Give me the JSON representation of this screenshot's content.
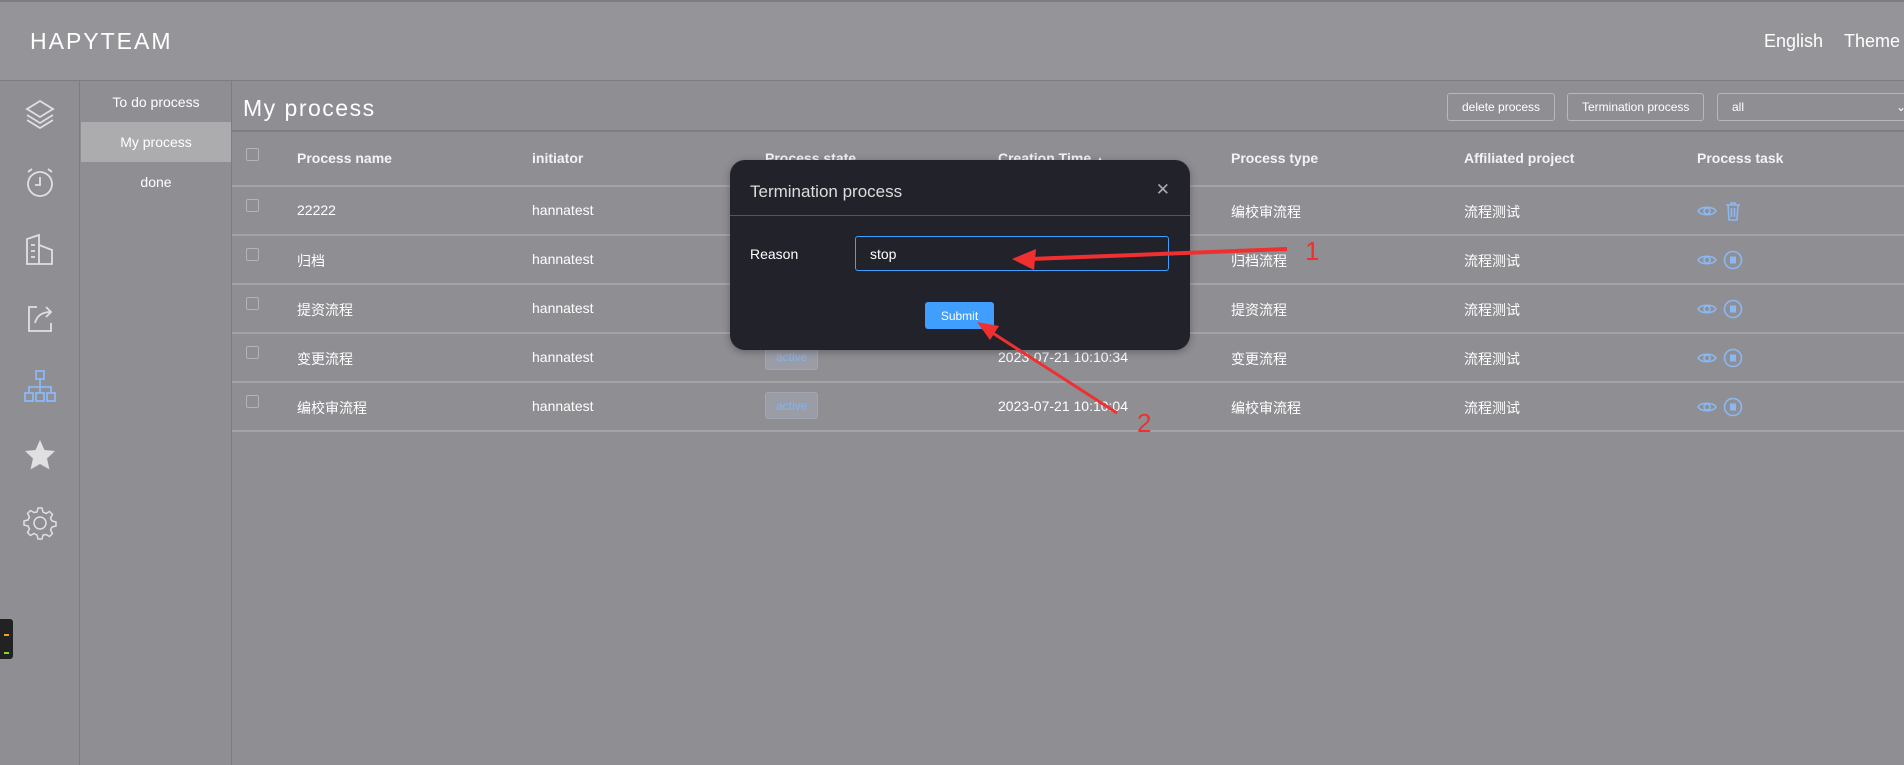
{
  "header": {
    "logo": "HAPYTEAM",
    "language": "English",
    "theme": "Theme"
  },
  "iconbar": [
    {
      "icon": "layers-icon"
    },
    {
      "icon": "alarm-clock-icon"
    },
    {
      "icon": "building-icon"
    },
    {
      "icon": "share-icon"
    },
    {
      "icon": "org-chart-icon",
      "active": true
    },
    {
      "icon": "star-icon"
    },
    {
      "icon": "gear-icon"
    }
  ],
  "submenu": {
    "items": [
      {
        "label": "To do process"
      },
      {
        "label": "My process",
        "active": true
      },
      {
        "label": "done"
      }
    ]
  },
  "main": {
    "title": "My process",
    "delete_label": "delete process",
    "termination_label": "Termination process",
    "filter_value": "all"
  },
  "table": {
    "headers": [
      "Process name",
      "initiator",
      "Process state",
      "Creation Time",
      "Process type",
      "Affiliated project",
      "Process task"
    ],
    "rows": [
      {
        "name": "22222",
        "initiator": "hannatest",
        "state": "",
        "time": "",
        "type": "编校审流程",
        "project": "流程测试",
        "task_icons": [
          "eye-icon",
          "trash-icon"
        ]
      },
      {
        "name": "归档",
        "initiator": "hannatest",
        "state": "",
        "time": "",
        "type": "归档流程",
        "project": "流程测试",
        "task_icons": [
          "eye-icon",
          "stop-icon"
        ]
      },
      {
        "name": "提资流程",
        "initiator": "hannatest",
        "state": "",
        "time": "",
        "type": "提资流程",
        "project": "流程测试",
        "task_icons": [
          "eye-icon",
          "stop-icon"
        ]
      },
      {
        "name": "变更流程",
        "initiator": "hannatest",
        "state": "active",
        "time": "2023-07-21 10:10:34",
        "type": "变更流程",
        "project": "流程测试",
        "task_icons": [
          "eye-icon",
          "stop-icon"
        ]
      },
      {
        "name": "编校审流程",
        "initiator": "hannatest",
        "state": "active",
        "time": "2023-07-21 10:10:04",
        "type": "编校审流程",
        "project": "流程测试",
        "task_icons": [
          "eye-icon",
          "stop-icon"
        ]
      }
    ]
  },
  "modal": {
    "title": "Termination process",
    "reason_label": "Reason",
    "reason_value": "stop",
    "submit_label": "Submit"
  },
  "annotations": {
    "label1": "1",
    "label2": "2",
    "color": "#f03030"
  },
  "colors": {
    "accent": "#409eff",
    "icon_blue": "#8ab8f5"
  }
}
